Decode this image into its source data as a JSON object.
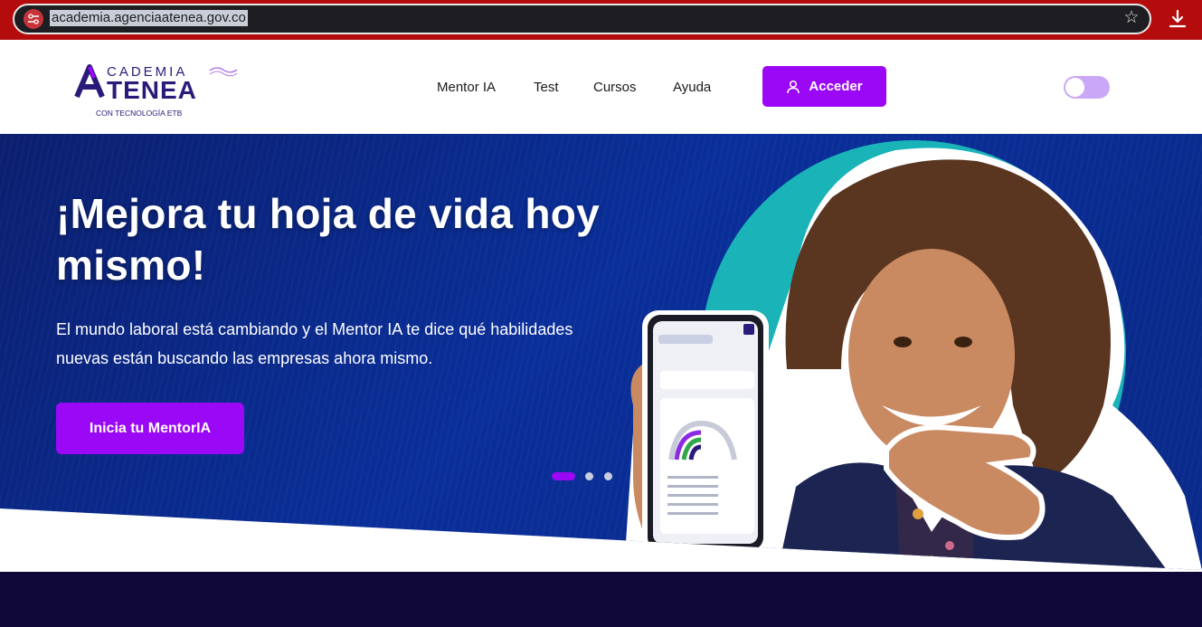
{
  "browser": {
    "url": "academia.agenciaatenea.gov.co",
    "site_info_icon": "tune-icon",
    "bookmark_icon": "star-icon",
    "download_icon": "download-icon"
  },
  "header": {
    "logo": {
      "top_text": "CADEMIA",
      "main_text": "TENEA",
      "tagline": "CON TECNOLOGÍA ETB"
    },
    "nav": [
      "Mentor IA",
      "Test",
      "Cursos",
      "Ayuda"
    ],
    "login_button": "Acceder",
    "login_icon": "user-icon",
    "theme_toggle": {
      "on": false
    }
  },
  "hero": {
    "title": "¡Mejora tu hoja de vida hoy mismo!",
    "description": "El mundo laboral está cambiando y el Mentor IA te dice qué habilidades nuevas están buscando las empresas ahora mismo.",
    "cta": "Inicia tu MentorIA",
    "carousel": {
      "slides": 3,
      "active": 0
    }
  },
  "colors": {
    "accent": "#9b08f5",
    "hero_bg": "#0a2a8c",
    "hero_teal": "#19b3b8",
    "bottom_band": "#0f0738",
    "browser_bar": "#b40c0c"
  }
}
